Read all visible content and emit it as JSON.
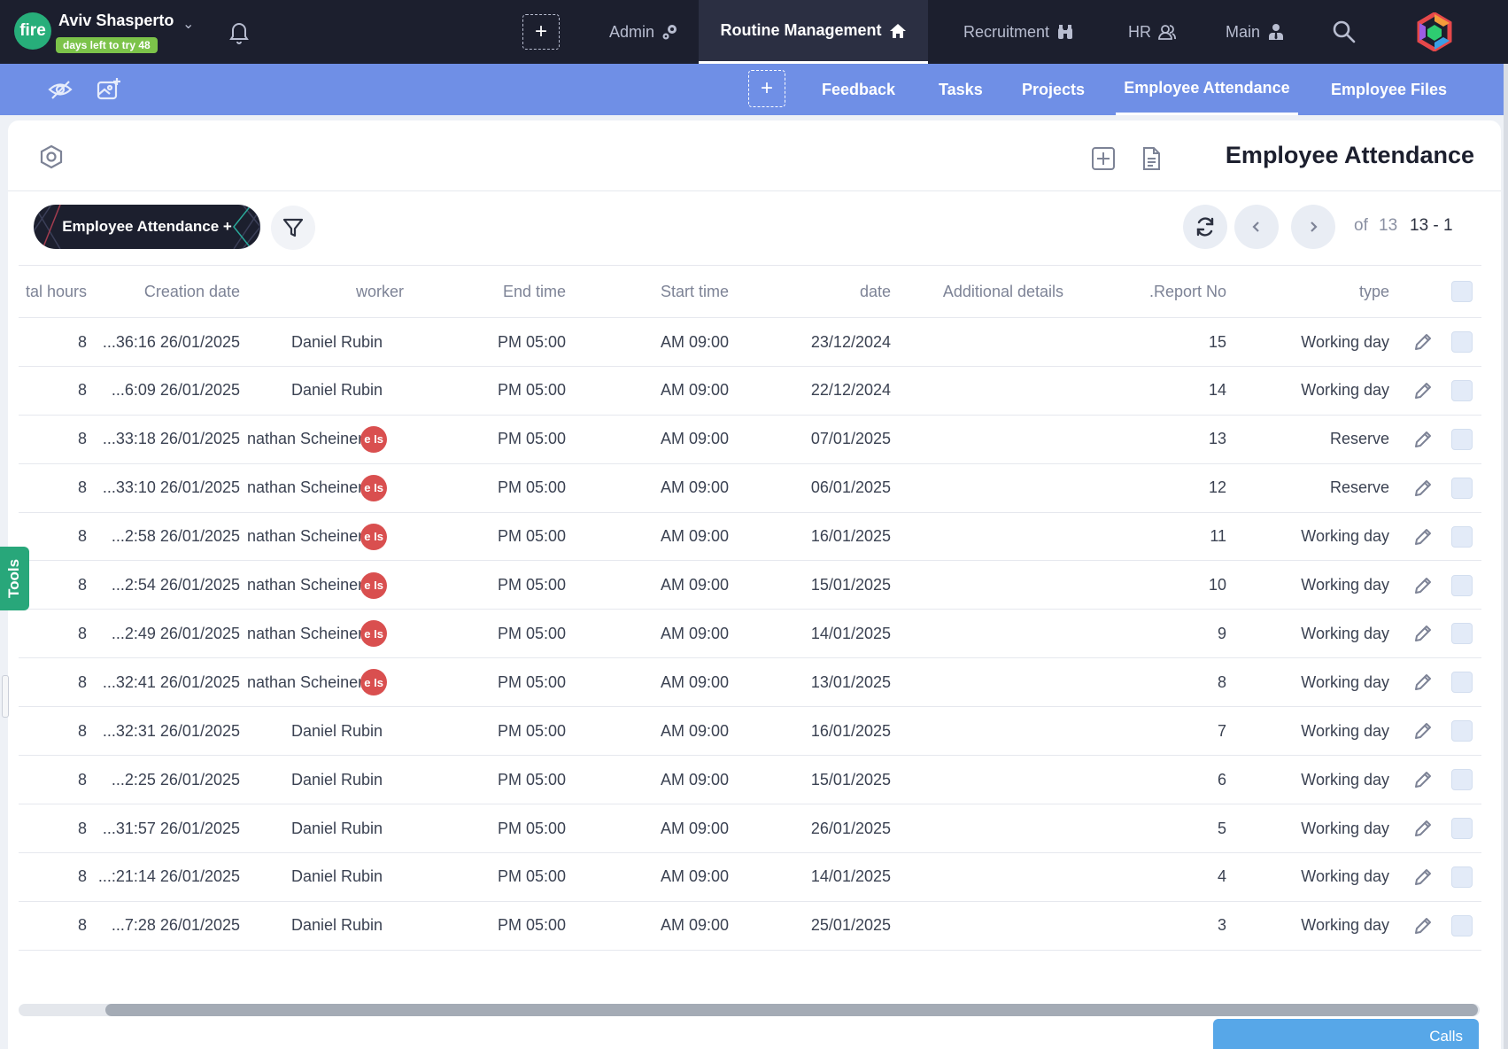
{
  "user": {
    "logo_text": "fire",
    "name": "Aviv Shasperto",
    "trial_badge": "days left to try 48"
  },
  "top_nav": {
    "tabs": [
      {
        "label": "Admin",
        "icon": "gears-icon"
      },
      {
        "label": "Routine Management",
        "icon": "home-icon",
        "active": true
      },
      {
        "label": "Recruitment",
        "icon": "binoculars-icon"
      },
      {
        "label": "HR",
        "icon": "users-icon"
      },
      {
        "label": "Main",
        "icon": "person-tie-icon"
      }
    ]
  },
  "sub_nav": {
    "tabs": [
      {
        "label": "Feedback"
      },
      {
        "label": "Tasks"
      },
      {
        "label": "Projects"
      },
      {
        "label": "Employee Attendance",
        "active": true
      },
      {
        "label": "Employee Files"
      }
    ]
  },
  "page": {
    "title": "Employee Attendance",
    "view_chip": "Employee Attendance +",
    "pager": {
      "of_label": "of",
      "total": "13",
      "range": "13 - 1"
    }
  },
  "table": {
    "headers": {
      "total_hours": "tal hours",
      "creation_date": "Creation date",
      "worker": "worker",
      "end_time": "End time",
      "start_time": "Start time",
      "date": "date",
      "additional_details": "Additional details",
      "report_no": ".Report No",
      "type": "type"
    },
    "rows": [
      {
        "total_hours": "8",
        "creation_date": "...36:16 26/01/2025",
        "worker": "Daniel Rubin",
        "avatar": "",
        "end_time": "PM 05:00",
        "start_time": "AM 09:00",
        "date": "23/12/2024",
        "additional_details": "",
        "report_no": "15",
        "type": "Working day"
      },
      {
        "total_hours": "8",
        "creation_date": "...6:09 26/01/2025",
        "worker": "Daniel Rubin",
        "avatar": "",
        "end_time": "PM 05:00",
        "start_time": "AM 09:00",
        "date": "22/12/2024",
        "additional_details": "",
        "report_no": "14",
        "type": "Working day"
      },
      {
        "total_hours": "8",
        "creation_date": "...33:18 26/01/2025",
        "worker": "nathan Scheinert",
        "avatar": "e Is",
        "end_time": "PM 05:00",
        "start_time": "AM 09:00",
        "date": "07/01/2025",
        "additional_details": "",
        "report_no": "13",
        "type": "Reserve"
      },
      {
        "total_hours": "8",
        "creation_date": "...33:10 26/01/2025",
        "worker": "nathan Scheinert",
        "avatar": "e Is",
        "end_time": "PM 05:00",
        "start_time": "AM 09:00",
        "date": "06/01/2025",
        "additional_details": "",
        "report_no": "12",
        "type": "Reserve"
      },
      {
        "total_hours": "8",
        "creation_date": "...2:58 26/01/2025",
        "worker": "nathan Scheinert",
        "avatar": "e Is",
        "end_time": "PM 05:00",
        "start_time": "AM 09:00",
        "date": "16/01/2025",
        "additional_details": "",
        "report_no": "11",
        "type": "Working day"
      },
      {
        "total_hours": "8",
        "creation_date": "...2:54 26/01/2025",
        "worker": "nathan Scheinert",
        "avatar": "e Is",
        "end_time": "PM 05:00",
        "start_time": "AM 09:00",
        "date": "15/01/2025",
        "additional_details": "",
        "report_no": "10",
        "type": "Working day"
      },
      {
        "total_hours": "8",
        "creation_date": "...2:49 26/01/2025",
        "worker": "nathan Scheinert",
        "avatar": "e Is",
        "end_time": "PM 05:00",
        "start_time": "AM 09:00",
        "date": "14/01/2025",
        "additional_details": "",
        "report_no": "9",
        "type": "Working day"
      },
      {
        "total_hours": "8",
        "creation_date": "...32:41 26/01/2025",
        "worker": "nathan Scheinert",
        "avatar": "e Is",
        "end_time": "PM 05:00",
        "start_time": "AM 09:00",
        "date": "13/01/2025",
        "additional_details": "",
        "report_no": "8",
        "type": "Working day"
      },
      {
        "total_hours": "8",
        "creation_date": "...32:31 26/01/2025",
        "worker": "Daniel Rubin",
        "avatar": "",
        "end_time": "PM 05:00",
        "start_time": "AM 09:00",
        "date": "16/01/2025",
        "additional_details": "",
        "report_no": "7",
        "type": "Working day"
      },
      {
        "total_hours": "8",
        "creation_date": "...2:25 26/01/2025",
        "worker": "Daniel Rubin",
        "avatar": "",
        "end_time": "PM 05:00",
        "start_time": "AM 09:00",
        "date": "15/01/2025",
        "additional_details": "",
        "report_no": "6",
        "type": "Working day"
      },
      {
        "total_hours": "8",
        "creation_date": "...31:57 26/01/2025",
        "worker": "Daniel Rubin",
        "avatar": "",
        "end_time": "PM 05:00",
        "start_time": "AM 09:00",
        "date": "26/01/2025",
        "additional_details": "",
        "report_no": "5",
        "type": "Working day"
      },
      {
        "total_hours": "8",
        "creation_date": "...:21:14 26/01/2025",
        "worker": "Daniel Rubin",
        "avatar": "",
        "end_time": "PM 05:00",
        "start_time": "AM 09:00",
        "date": "14/01/2025",
        "additional_details": "",
        "report_no": "4",
        "type": "Working day"
      },
      {
        "total_hours": "8",
        "creation_date": "...7:28 26/01/2025",
        "worker": "Daniel Rubin",
        "avatar": "",
        "end_time": "PM 05:00",
        "start_time": "AM 09:00",
        "date": "25/01/2025",
        "additional_details": "",
        "report_no": "3",
        "type": "Working day"
      }
    ]
  },
  "side": {
    "tools_label": "Tools",
    "calls_label": "Calls"
  },
  "colors": {
    "topbar": "#1c1f2e",
    "subbar": "#6f8fe6",
    "logo": "#27ae7a",
    "trial_badge": "#7cc34a",
    "avatar": "#d94f4f",
    "tools_tab": "#28a77a",
    "calls": "#57a7e8"
  }
}
